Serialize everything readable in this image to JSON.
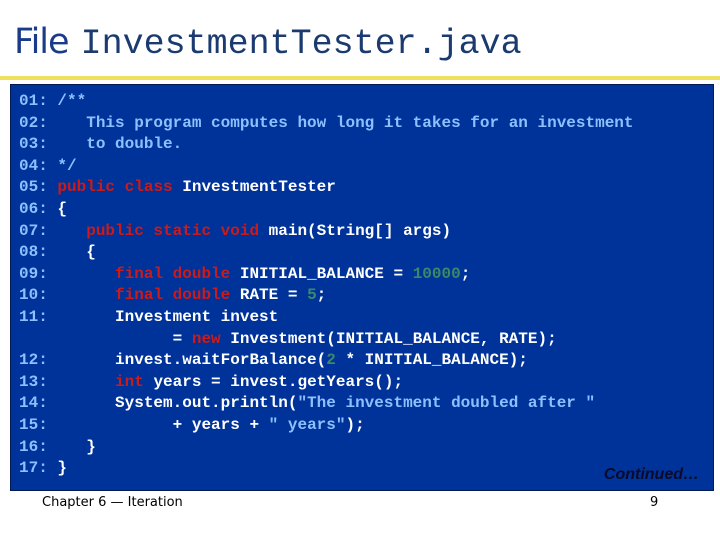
{
  "title": {
    "prefix": "File",
    "filename": "InvestmentTester.java"
  },
  "code": {
    "lines": [
      {
        "num": "01:",
        "segments": [
          {
            "t": " /**",
            "c": "cm"
          }
        ]
      },
      {
        "num": "02:",
        "segments": [
          {
            "t": "    This program computes how long it takes for an investment",
            "c": "cm"
          }
        ]
      },
      {
        "num": "03:",
        "segments": [
          {
            "t": "    to double.",
            "c": "cm"
          }
        ]
      },
      {
        "num": "04:",
        "segments": [
          {
            "t": " */",
            "c": "cm"
          }
        ]
      },
      {
        "num": "05:",
        "segments": [
          {
            "t": " ",
            "c": ""
          },
          {
            "t": "public class",
            "c": "kw"
          },
          {
            "t": " InvestmentTester",
            "c": ""
          }
        ]
      },
      {
        "num": "06:",
        "segments": [
          {
            "t": " {",
            "c": ""
          }
        ]
      },
      {
        "num": "07:",
        "segments": [
          {
            "t": "    ",
            "c": ""
          },
          {
            "t": "public static void",
            "c": "kw"
          },
          {
            "t": " main(String[] args)",
            "c": ""
          }
        ]
      },
      {
        "num": "08:",
        "segments": [
          {
            "t": "    {",
            "c": ""
          }
        ]
      },
      {
        "num": "09:",
        "segments": [
          {
            "t": "       ",
            "c": ""
          },
          {
            "t": "final double",
            "c": "kw"
          },
          {
            "t": " INITIAL_BALANCE = ",
            "c": ""
          },
          {
            "t": "10000",
            "c": "num"
          },
          {
            "t": ";",
            "c": ""
          }
        ]
      },
      {
        "num": "10:",
        "segments": [
          {
            "t": "       ",
            "c": ""
          },
          {
            "t": "final double",
            "c": "kw"
          },
          {
            "t": " RATE = ",
            "c": ""
          },
          {
            "t": "5",
            "c": "num"
          },
          {
            "t": ";",
            "c": ""
          }
        ]
      },
      {
        "num": "11:",
        "segments": [
          {
            "t": "       Investment invest",
            "c": ""
          }
        ]
      },
      {
        "num": "",
        "segments": [
          {
            "t": "             = ",
            "c": ""
          },
          {
            "t": "new",
            "c": "kw"
          },
          {
            "t": " Investment(INITIAL_BALANCE, RATE);",
            "c": ""
          }
        ]
      },
      {
        "num": "12:",
        "segments": [
          {
            "t": "       invest.waitForBalance(",
            "c": ""
          },
          {
            "t": "2",
            "c": "num"
          },
          {
            "t": " * INITIAL_BALANCE);",
            "c": ""
          }
        ]
      },
      {
        "num": "13:",
        "segments": [
          {
            "t": "       ",
            "c": ""
          },
          {
            "t": "int",
            "c": "kw"
          },
          {
            "t": " years = invest.getYears();",
            "c": ""
          }
        ]
      },
      {
        "num": "14:",
        "segments": [
          {
            "t": "       System.out.println(",
            "c": ""
          },
          {
            "t": "\"The investment doubled after \"",
            "c": "str"
          }
        ]
      },
      {
        "num": "15:",
        "segments": [
          {
            "t": "             + years + ",
            "c": ""
          },
          {
            "t": "\" years\"",
            "c": "str"
          },
          {
            "t": ");",
            "c": ""
          }
        ]
      },
      {
        "num": "16:",
        "segments": [
          {
            "t": "    }",
            "c": ""
          }
        ]
      },
      {
        "num": "17:",
        "segments": [
          {
            "t": " }",
            "c": ""
          }
        ]
      }
    ]
  },
  "continued_label": "Continued…",
  "footer": {
    "chapter": "Chapter 6 — Iteration",
    "page": "9"
  }
}
